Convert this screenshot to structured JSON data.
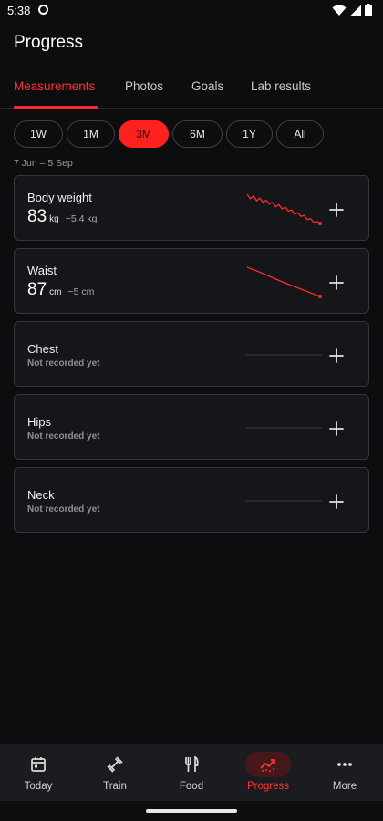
{
  "status_bar": {
    "time": "5:38",
    "icons": [
      "app-notification-icon",
      "wifi-icon",
      "signal-icon",
      "battery-icon"
    ]
  },
  "header": {
    "title": "Progress"
  },
  "tabs": [
    {
      "label": "Measurements",
      "active": true
    },
    {
      "label": "Photos",
      "active": false
    },
    {
      "label": "Goals",
      "active": false
    },
    {
      "label": "Lab results",
      "active": false
    }
  ],
  "ranges": {
    "options": [
      "1W",
      "1M",
      "3M",
      "6M",
      "1Y",
      "All"
    ],
    "selected": "3M",
    "date_range": "7 Jun – 5 Sep"
  },
  "measurements": [
    {
      "name": "Body weight",
      "value": "83",
      "unit": "kg",
      "delta": "−5.4 kg",
      "empty_text": "",
      "trend": [
        88.4,
        87.6,
        88.1,
        87.2,
        87.7,
        86.9,
        87.3,
        86.6,
        86.9,
        86.1,
        86.5,
        85.7,
        86.0,
        85.3,
        85.5,
        84.7,
        85.0,
        84.3,
        84.5,
        83.7,
        83.9,
        83.2,
        83.4,
        83.0
      ]
    },
    {
      "name": "Waist",
      "value": "87",
      "unit": "cm",
      "delta": "−5 cm",
      "empty_text": "",
      "trend": [
        92,
        91.2,
        90.3,
        89.4,
        88.6,
        87.8,
        87
      ]
    },
    {
      "name": "Chest",
      "value": "",
      "unit": "",
      "delta": "",
      "empty_text": "Not recorded yet",
      "trend": []
    },
    {
      "name": "Hips",
      "value": "",
      "unit": "",
      "delta": "",
      "empty_text": "Not recorded yet",
      "trend": []
    },
    {
      "name": "Neck",
      "value": "",
      "unit": "",
      "delta": "",
      "empty_text": "Not recorded yet",
      "trend": []
    }
  ],
  "bottom_nav": [
    {
      "label": "Today",
      "icon": "calendar-icon",
      "active": false
    },
    {
      "label": "Train",
      "icon": "dumbbell-icon",
      "active": false
    },
    {
      "label": "Food",
      "icon": "fork-knife-icon",
      "active": false
    },
    {
      "label": "Progress",
      "icon": "trending-chart-icon",
      "active": true
    },
    {
      "label": "More",
      "icon": "more-dots-icon",
      "active": false
    }
  ],
  "colors": {
    "accent": "#ff2a2a",
    "background": "#0c0d0f",
    "card": "#151619",
    "card_border": "#34363b",
    "nav_active_bg": "#46181a"
  }
}
